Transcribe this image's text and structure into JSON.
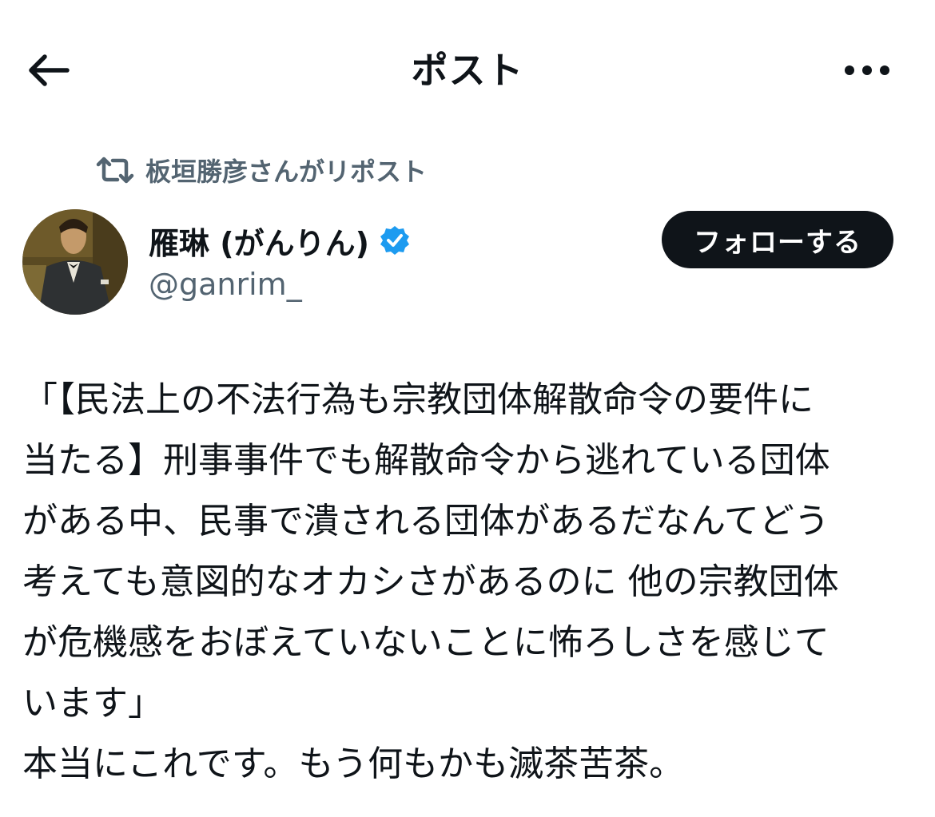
{
  "header": {
    "title": "ポスト",
    "back_icon": "arrow-left-icon",
    "more_icon": "more-horizontal-icon"
  },
  "repost": {
    "icon": "repost-icon",
    "text": "板垣勝彦さんがリポスト"
  },
  "author": {
    "display_name": "雁琳 (がんりん)",
    "handle": "@ganrim_",
    "verified": true,
    "verified_color": "#1d9bf0"
  },
  "follow_button": {
    "label": "フォローする"
  },
  "post": {
    "lines": [
      "「【民法上の不法行為も宗教団体解散命令の要件に",
      "当たる】刑事事件でも解散命令から逃れている団体",
      "がある中、民事で潰される団体があるだなんてどう",
      "考えても意図的なオカシさがあるのに 他の宗教団体",
      "が危機感をおぼえていないことに怖ろしさを感じて",
      "います」",
      "本当にこれです。もう何もかも滅茶苦茶。"
    ]
  },
  "colors": {
    "text": "#0f1419",
    "secondary": "#536471",
    "follow_bg": "#0f1419"
  }
}
